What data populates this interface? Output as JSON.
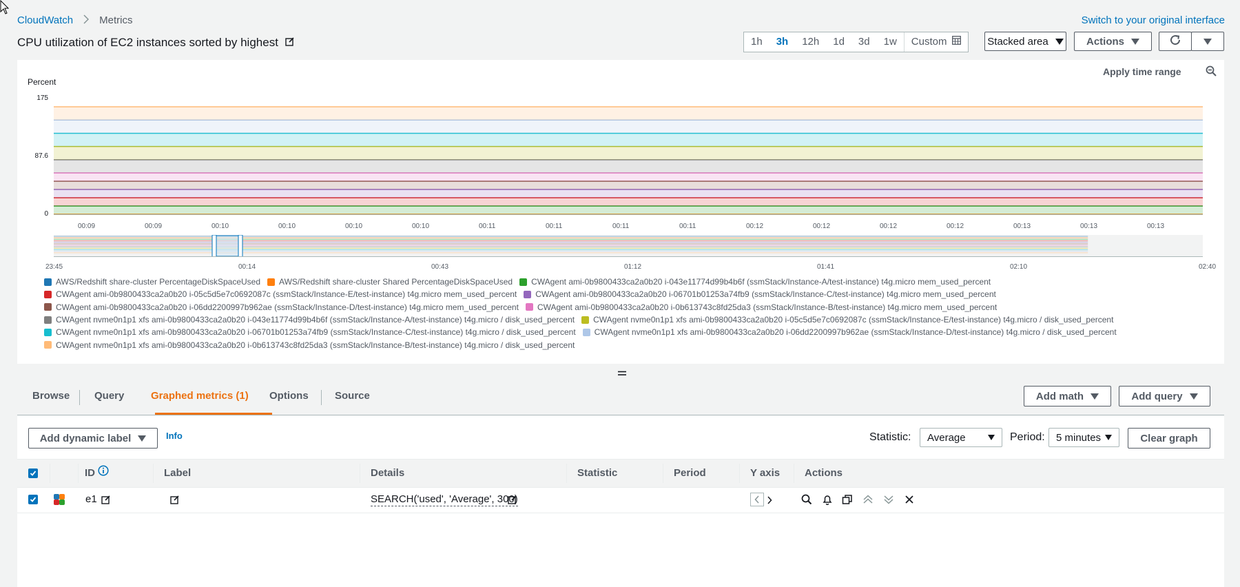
{
  "breadcrumb": {
    "root": "CloudWatch",
    "current": "Metrics"
  },
  "switch_link": "Switch to your original interface",
  "title": "CPU utilization of EC2 instances sorted by highest",
  "time_range": {
    "options": [
      "1h",
      "3h",
      "12h",
      "1d",
      "3d",
      "1w"
    ],
    "active": "3h",
    "custom": "Custom"
  },
  "graph_type": "Stacked area",
  "actions_label": "Actions",
  "apply_time_range": "Apply time range",
  "colors": {
    "accent": "#ec7211",
    "link": "#0073bb"
  },
  "chart_data": {
    "type": "area",
    "stacked": true,
    "ylabel": "Percent",
    "yticks": [
      "175",
      "87.6",
      "0"
    ],
    "ylim": [
      0,
      175
    ],
    "x": [
      "00:09",
      "00:09",
      "00:10",
      "00:10",
      "00:10",
      "00:10",
      "00:11",
      "00:11",
      "00:11",
      "00:11",
      "00:12",
      "00:12",
      "00:12",
      "00:12",
      "00:13",
      "00:13",
      "00:13"
    ],
    "minimap_ticks": [
      "23:45",
      "00:14",
      "00:43",
      "01:12",
      "01:41",
      "02:10",
      "02:40"
    ],
    "series": [
      {
        "name": "AWS/Redshift share-cluster PercentageDiskSpaceUsed",
        "color": "#1f77b4",
        "value": 0.5
      },
      {
        "name": "AWS/Redshift share-cluster Shared PercentageDiskSpaceUsed",
        "color": "#ff7f0e",
        "value": 0.5
      },
      {
        "name": "CWAgent ami-0b9800433ca2a0b20 i-043e11774d99b4b6f (ssmStack/Instance-A/test-instance) t4g.micro mem_used_percent",
        "color": "#2ca02c",
        "value": 12.5
      },
      {
        "name": "CWAgent ami-0b9800433ca2a0b20 i-05c5d5e7c0692087c (ssmStack/Instance-E/test-instance) t4g.micro mem_used_percent",
        "color": "#d62728",
        "value": 12.5
      },
      {
        "name": "CWAgent ami-0b9800433ca2a0b20 i-06701b01253a74fb9 (ssmStack/Instance-C/test-instance) t4g.micro mem_used_percent",
        "color": "#9467bd",
        "value": 12.5
      },
      {
        "name": "CWAgent ami-0b9800433ca2a0b20 i-06dd2200997b962ae (ssmStack/Instance-D/test-instance) t4g.micro mem_used_percent",
        "color": "#8c564b",
        "value": 12.5
      },
      {
        "name": "CWAgent ami-0b9800433ca2a0b20 i-0b613743c8fd25da3 (ssmStack/Instance-B/test-instance) t4g.micro mem_used_percent",
        "color": "#e377c2",
        "value": 12.5
      },
      {
        "name": "CWAgent nvme0n1p1 xfs ami-0b9800433ca2a0b20 i-043e11774d99b4b6f (ssmStack/Instance-A/test-instance) t4g.micro / disk_used_percent",
        "color": "#7f7f7f",
        "value": 20
      },
      {
        "name": "CWAgent nvme0n1p1 xfs ami-0b9800433ca2a0b20 i-05c5d5e7c0692087c (ssmStack/Instance-E/test-instance) t4g.micro / disk_used_percent",
        "color": "#bcbd22",
        "value": 20
      },
      {
        "name": "CWAgent nvme0n1p1 xfs ami-0b9800433ca2a0b20 i-06701b01253a74fb9 (ssmStack/Instance-C/test-instance) t4g.micro / disk_used_percent",
        "color": "#17becf",
        "value": 20
      },
      {
        "name": "CWAgent nvme0n1p1 xfs ami-0b9800433ca2a0b20 i-06dd2200997b962ae (ssmStack/Instance-D/test-instance) t4g.micro / disk_used_percent",
        "color": "#aec7e8",
        "value": 20
      },
      {
        "name": "CWAgent nvme0n1p1 xfs ami-0b9800433ca2a0b20 i-0b613743c8fd25da3 (ssmStack/Instance-B/test-instance) t4g.micro / disk_used_percent",
        "color": "#ffbb78",
        "value": 20
      }
    ]
  },
  "legend_rows": [
    [
      0,
      1,
      2
    ],
    [
      3,
      4
    ],
    [
      5,
      6
    ],
    [
      7,
      8
    ],
    [
      9,
      10
    ],
    [
      11
    ]
  ],
  "tabs": [
    "Browse",
    "Query",
    "Graphed metrics (1)",
    "Options",
    "Source"
  ],
  "active_tab": "Graphed metrics (1)",
  "add_math": "Add math",
  "add_query": "Add query",
  "add_dynamic_label": "Add dynamic label",
  "info": "Info",
  "statistic": {
    "label": "Statistic:",
    "value": "Average"
  },
  "period": {
    "label": "Period:",
    "value": "5 minutes"
  },
  "clear_graph": "Clear graph",
  "table": {
    "headers": [
      "ID",
      "Label",
      "Details",
      "Statistic",
      "Period",
      "Y axis",
      "Actions"
    ],
    "rows": [
      {
        "id": "e1",
        "label": "",
        "details": "SEARCH('used', 'Average', 300)",
        "statistic": "",
        "period": ""
      }
    ]
  }
}
